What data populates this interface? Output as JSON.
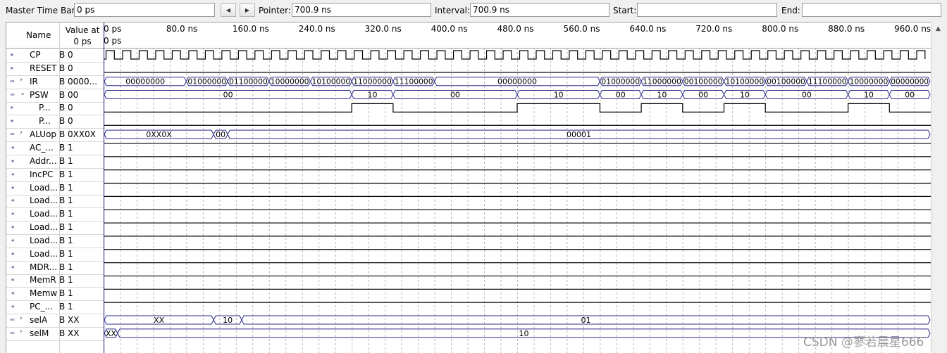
{
  "toolbar": {
    "master_time_bar_label": "Master Time Bar:",
    "master_time_bar_value": "0 ps",
    "prev_icon": "triangle-left",
    "next_icon": "triangle-right",
    "pointer_label": "Pointer:",
    "pointer_value": "700.9 ns",
    "interval_label": "Interval:",
    "interval_value": "700.9 ns",
    "start_label": "Start:",
    "start_value": "",
    "end_label": "End:",
    "end_value": ""
  },
  "header": {
    "name": "Name",
    "value_at_line1": "Value at",
    "value_at_line2": "0 ps",
    "time_ticks": [
      "0 ps",
      "80.0 ns",
      "160.0 ns",
      "240.0 ns",
      "320.0 ns",
      "400.0 ns",
      "480.0 ns",
      "560.0 ns",
      "640.0 ns",
      "720.0 ns",
      "800.0 ns",
      "880.0 ns",
      "960.0 ns"
    ],
    "marker_label": "0 ps"
  },
  "time_range_ns": [
    0,
    1000
  ],
  "colors": {
    "wave": "#000000",
    "bus": "#2b2b8c",
    "cursor": "#2b2b8c",
    "grid": "#b8b8b8"
  },
  "signals": [
    {
      "icon": "input-pin-icon",
      "expand": "",
      "name": "CP",
      "value": "B 0",
      "kind": "clock",
      "period_ns": 20
    },
    {
      "icon": "input-pin-icon",
      "expand": "",
      "name": "RESET",
      "value": "B 0",
      "kind": "bit",
      "segments": [
        {
          "t0": 0,
          "t1": 1000,
          "v": 0
        }
      ]
    },
    {
      "icon": "input-bus-icon",
      "expand": ">",
      "name": "IR",
      "value": "B 0000...",
      "kind": "bus",
      "segments": [
        {
          "t0": 0,
          "t1": 100,
          "label": "00000000"
        },
        {
          "t0": 100,
          "t1": 150,
          "label": "01000000"
        },
        {
          "t0": 150,
          "t1": 200,
          "label": "01100000"
        },
        {
          "t0": 200,
          "t1": 250,
          "label": "10000000"
        },
        {
          "t0": 250,
          "t1": 300,
          "label": "10100000"
        },
        {
          "t0": 300,
          "t1": 350,
          "label": "11000000"
        },
        {
          "t0": 350,
          "t1": 400,
          "label": "11100000"
        },
        {
          "t0": 400,
          "t1": 600,
          "label": "00000000"
        },
        {
          "t0": 600,
          "t1": 650,
          "label": "01000000"
        },
        {
          "t0": 650,
          "t1": 700,
          "label": "11000000"
        },
        {
          "t0": 700,
          "t1": 750,
          "label": "00100000"
        },
        {
          "t0": 750,
          "t1": 800,
          "label": "10100000"
        },
        {
          "t0": 800,
          "t1": 850,
          "label": "00100000"
        },
        {
          "t0": 850,
          "t1": 900,
          "label": "11100000"
        },
        {
          "t0": 900,
          "t1": 950,
          "label": "10000000"
        },
        {
          "t0": 950,
          "t1": 1000,
          "label": "00000000"
        }
      ]
    },
    {
      "icon": "input-bus-icon",
      "expand": "v",
      "name": "PSW",
      "value": "B 00",
      "kind": "bus",
      "segments": [
        {
          "t0": 0,
          "t1": 300,
          "label": "00"
        },
        {
          "t0": 300,
          "t1": 350,
          "label": "10"
        },
        {
          "t0": 350,
          "t1": 500,
          "label": "00"
        },
        {
          "t0": 500,
          "t1": 600,
          "label": "10"
        },
        {
          "t0": 600,
          "t1": 650,
          "label": "00"
        },
        {
          "t0": 650,
          "t1": 700,
          "label": "10"
        },
        {
          "t0": 700,
          "t1": 750,
          "label": "00"
        },
        {
          "t0": 750,
          "t1": 800,
          "label": "10"
        },
        {
          "t0": 800,
          "t1": 900,
          "label": "00"
        },
        {
          "t0": 900,
          "t1": 950,
          "label": "10"
        },
        {
          "t0": 950,
          "t1": 1000,
          "label": "00"
        }
      ]
    },
    {
      "icon": "input-pin-icon",
      "expand": "",
      "name": "P...",
      "value": "B 0",
      "kind": "bit",
      "indent": true,
      "segments": [
        {
          "t0": 0,
          "t1": 300,
          "v": 0
        },
        {
          "t0": 300,
          "t1": 350,
          "v": 1
        },
        {
          "t0": 350,
          "t1": 500,
          "v": 0
        },
        {
          "t0": 500,
          "t1": 600,
          "v": 1
        },
        {
          "t0": 600,
          "t1": 650,
          "v": 0
        },
        {
          "t0": 650,
          "t1": 700,
          "v": 1
        },
        {
          "t0": 700,
          "t1": 750,
          "v": 0
        },
        {
          "t0": 750,
          "t1": 800,
          "v": 1
        },
        {
          "t0": 800,
          "t1": 900,
          "v": 0
        },
        {
          "t0": 900,
          "t1": 950,
          "v": 1
        },
        {
          "t0": 950,
          "t1": 1000,
          "v": 0
        }
      ]
    },
    {
      "icon": "input-pin-icon",
      "expand": "",
      "name": "P...",
      "value": "B 0",
      "kind": "bit",
      "indent": true,
      "segments": [
        {
          "t0": 0,
          "t1": 1000,
          "v": 0
        }
      ]
    },
    {
      "icon": "output-bus-icon",
      "expand": ">",
      "name": "ALUop",
      "value": "B 0XX0X",
      "kind": "bus",
      "segments": [
        {
          "t0": 0,
          "t1": 133,
          "label": "0XX0X"
        },
        {
          "t0": 133,
          "t1": 150,
          "label": "00"
        },
        {
          "t0": 150,
          "t1": 1000,
          "label": "00001"
        }
      ]
    },
    {
      "icon": "output-pin-icon",
      "expand": "",
      "name": "AC_...",
      "value": "B 1",
      "kind": "bit",
      "segments": [
        {
          "t0": 0,
          "t1": 1000,
          "v": 1
        }
      ]
    },
    {
      "icon": "output-pin-icon",
      "expand": "",
      "name": "Addr...",
      "value": "B 1",
      "kind": "bit",
      "segments": [
        {
          "t0": 0,
          "t1": 1000,
          "v": 1
        }
      ]
    },
    {
      "icon": "output-pin-icon",
      "expand": "",
      "name": "IncPC",
      "value": "B 1",
      "kind": "bit",
      "segments": [
        {
          "t0": 0,
          "t1": 1000,
          "v": 1
        }
      ]
    },
    {
      "icon": "output-pin-icon",
      "expand": "",
      "name": "Load...",
      "value": "B 1",
      "kind": "bit",
      "segments": [
        {
          "t0": 0,
          "t1": 1000,
          "v": 1
        }
      ]
    },
    {
      "icon": "output-pin-icon",
      "expand": "",
      "name": "Load...",
      "value": "B 1",
      "kind": "bit",
      "segments": [
        {
          "t0": 0,
          "t1": 1000,
          "v": 1
        }
      ]
    },
    {
      "icon": "output-pin-icon",
      "expand": "",
      "name": "Load...",
      "value": "B 1",
      "kind": "bit",
      "segments": [
        {
          "t0": 0,
          "t1": 1000,
          "v": 1
        }
      ]
    },
    {
      "icon": "output-pin-icon",
      "expand": "",
      "name": "Load...",
      "value": "B 1",
      "kind": "bit",
      "segments": [
        {
          "t0": 0,
          "t1": 1000,
          "v": 1
        }
      ]
    },
    {
      "icon": "output-pin-icon",
      "expand": "",
      "name": "Load...",
      "value": "B 1",
      "kind": "bit",
      "segments": [
        {
          "t0": 0,
          "t1": 1000,
          "v": 1
        }
      ]
    },
    {
      "icon": "output-pin-icon",
      "expand": "",
      "name": "Load...",
      "value": "B 1",
      "kind": "bit",
      "segments": [
        {
          "t0": 0,
          "t1": 1000,
          "v": 1
        }
      ]
    },
    {
      "icon": "output-pin-icon",
      "expand": "",
      "name": "MDR...",
      "value": "B 1",
      "kind": "bit",
      "segments": [
        {
          "t0": 0,
          "t1": 1000,
          "v": 1
        }
      ]
    },
    {
      "icon": "output-pin-icon",
      "expand": "",
      "name": "MemR",
      "value": "B 1",
      "kind": "bit",
      "segments": [
        {
          "t0": 0,
          "t1": 1000,
          "v": 1
        }
      ]
    },
    {
      "icon": "output-pin-icon",
      "expand": "",
      "name": "Memw",
      "value": "B 1",
      "kind": "bit",
      "segments": [
        {
          "t0": 0,
          "t1": 1000,
          "v": 1
        }
      ]
    },
    {
      "icon": "output-pin-icon",
      "expand": "",
      "name": "PC_...",
      "value": "B 1",
      "kind": "bit",
      "segments": [
        {
          "t0": 0,
          "t1": 1000,
          "v": 1
        }
      ]
    },
    {
      "icon": "output-bus-icon",
      "expand": ">",
      "name": "selA",
      "value": "B XX",
      "kind": "bus",
      "segments": [
        {
          "t0": 0,
          "t1": 133,
          "label": "XX"
        },
        {
          "t0": 133,
          "t1": 167,
          "label": "10"
        },
        {
          "t0": 167,
          "t1": 1000,
          "label": "01"
        }
      ]
    },
    {
      "icon": "output-bus-icon",
      "expand": ">",
      "name": "selM",
      "value": "B XX",
      "kind": "bus",
      "segments": [
        {
          "t0": 0,
          "t1": 17,
          "label": "XX"
        },
        {
          "t0": 17,
          "t1": 1000,
          "label": "10"
        }
      ]
    }
  ],
  "watermark": "CSDN @寥若晨星666"
}
